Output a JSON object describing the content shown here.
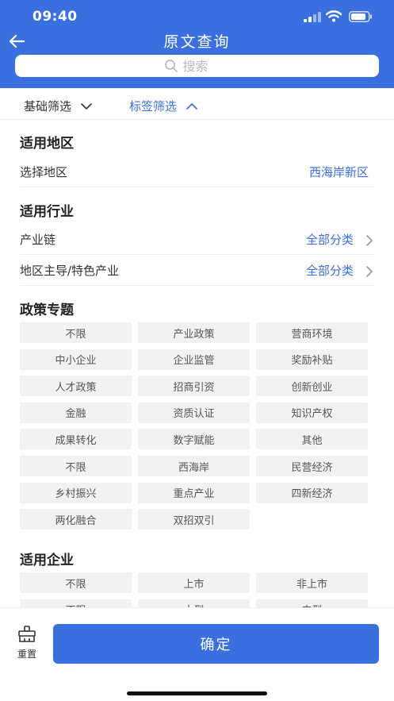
{
  "status": {
    "time": "09:40"
  },
  "header": {
    "title": "原文查询"
  },
  "search": {
    "placeholder": "搜索"
  },
  "filter_tabs": [
    {
      "label": "基础筛选",
      "active": false
    },
    {
      "label": "标签筛选",
      "active": true
    }
  ],
  "sections": {
    "region": {
      "title": "适用地区",
      "rows": [
        {
          "label": "选择地区",
          "value": "西海岸新区"
        }
      ]
    },
    "industry": {
      "title": "适用行业",
      "rows": [
        {
          "label": "产业链",
          "value": "全部分类"
        },
        {
          "label": "地区主导/特色产业",
          "value": "全部分类"
        }
      ]
    },
    "policy": {
      "title": "政策专题",
      "tags": [
        "不限",
        "产业政策",
        "营商环境",
        "中小企业",
        "企业监管",
        "奖励补贴",
        "人才政策",
        "招商引资",
        "创新创业",
        "金融",
        "资质认证",
        "知识产权",
        "成果转化",
        "数字赋能",
        "其他",
        "不限",
        "西海岸",
        "民营经济",
        "乡村振兴",
        "重点产业",
        "四新经济",
        "两化融合",
        "双招双引"
      ]
    },
    "enterprise": {
      "title": "适用企业",
      "tags": [
        "不限",
        "上市",
        "非上市",
        "不限",
        "大型",
        "中型"
      ]
    }
  },
  "bottom": {
    "reset_label": "重置",
    "confirm_label": "确定"
  },
  "colors": {
    "accent": "#3a6fe0",
    "tag_bg": "#f2f2f2"
  }
}
